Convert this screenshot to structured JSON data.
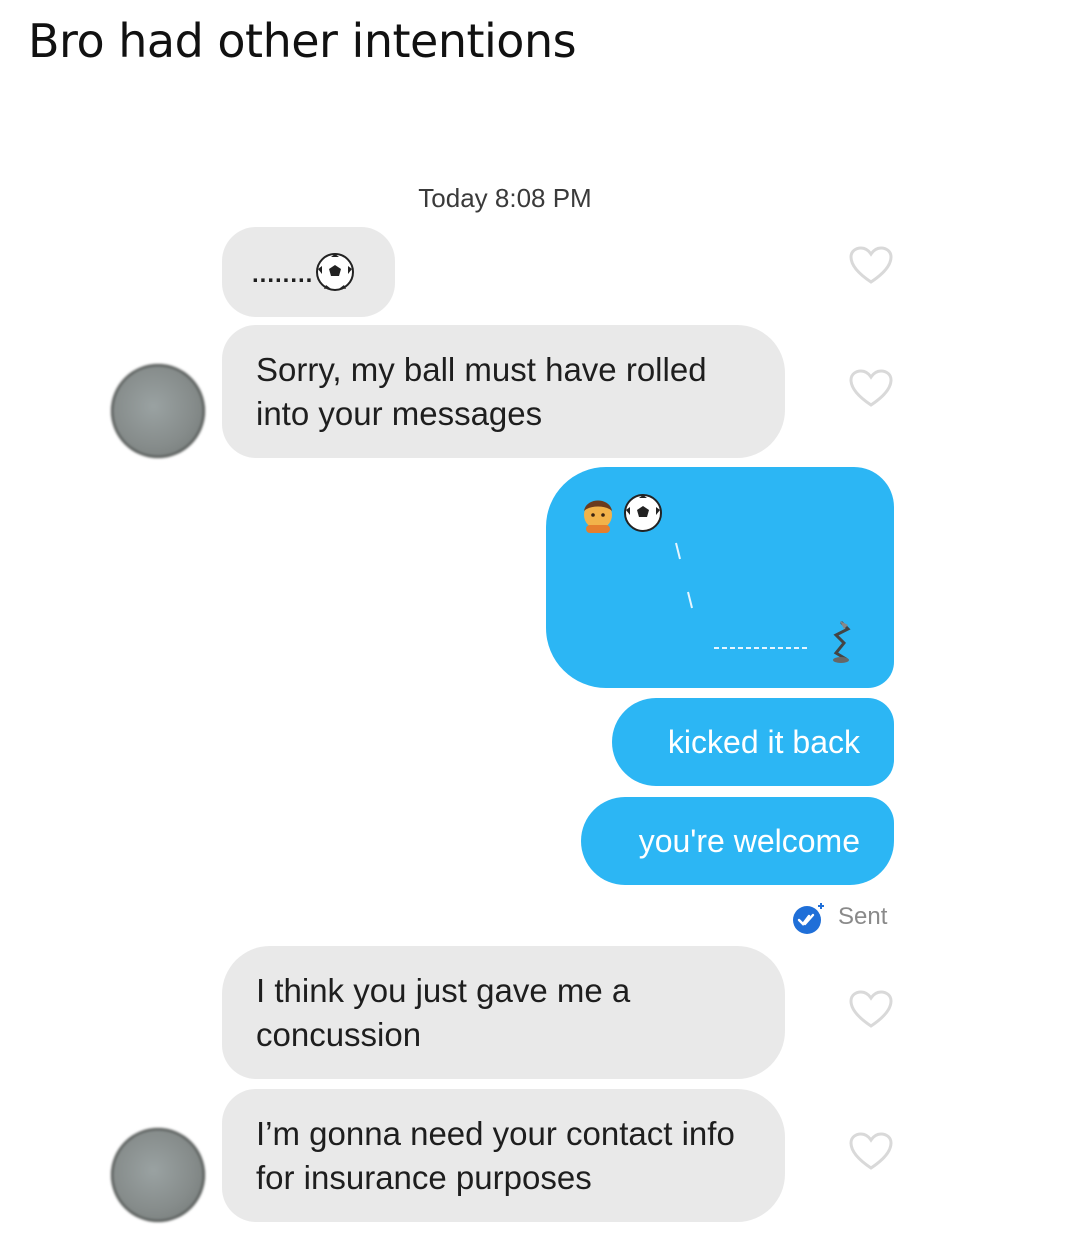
{
  "post": {
    "caption": "Bro had other intentions"
  },
  "chat": {
    "timestamp": "Today 8:08 PM",
    "messages": [
      {
        "id": "m1",
        "sender": "them",
        "text": "........",
        "emoji": "soccer-ball"
      },
      {
        "id": "m2",
        "sender": "them",
        "text": "Sorry, my ball must have rolled into your messages"
      },
      {
        "id": "m3",
        "sender": "me",
        "emoji_art": "person-kicking-ball-to-lamp"
      },
      {
        "id": "m4",
        "sender": "me",
        "text": "kicked it back"
      },
      {
        "id": "m5",
        "sender": "me",
        "text": "you're welcome"
      },
      {
        "id": "m6",
        "sender": "them",
        "text": "I think you just gave me a concussion"
      },
      {
        "id": "m7",
        "sender": "them",
        "text": "I’m gonna need your contact info for insurance purposes"
      }
    ],
    "status": {
      "label": "Sent",
      "icon": "sent-check-icon"
    }
  },
  "colors": {
    "incoming": "#e9e9e9",
    "outgoing": "#2cb6f4",
    "status": "#1f6fd8"
  }
}
